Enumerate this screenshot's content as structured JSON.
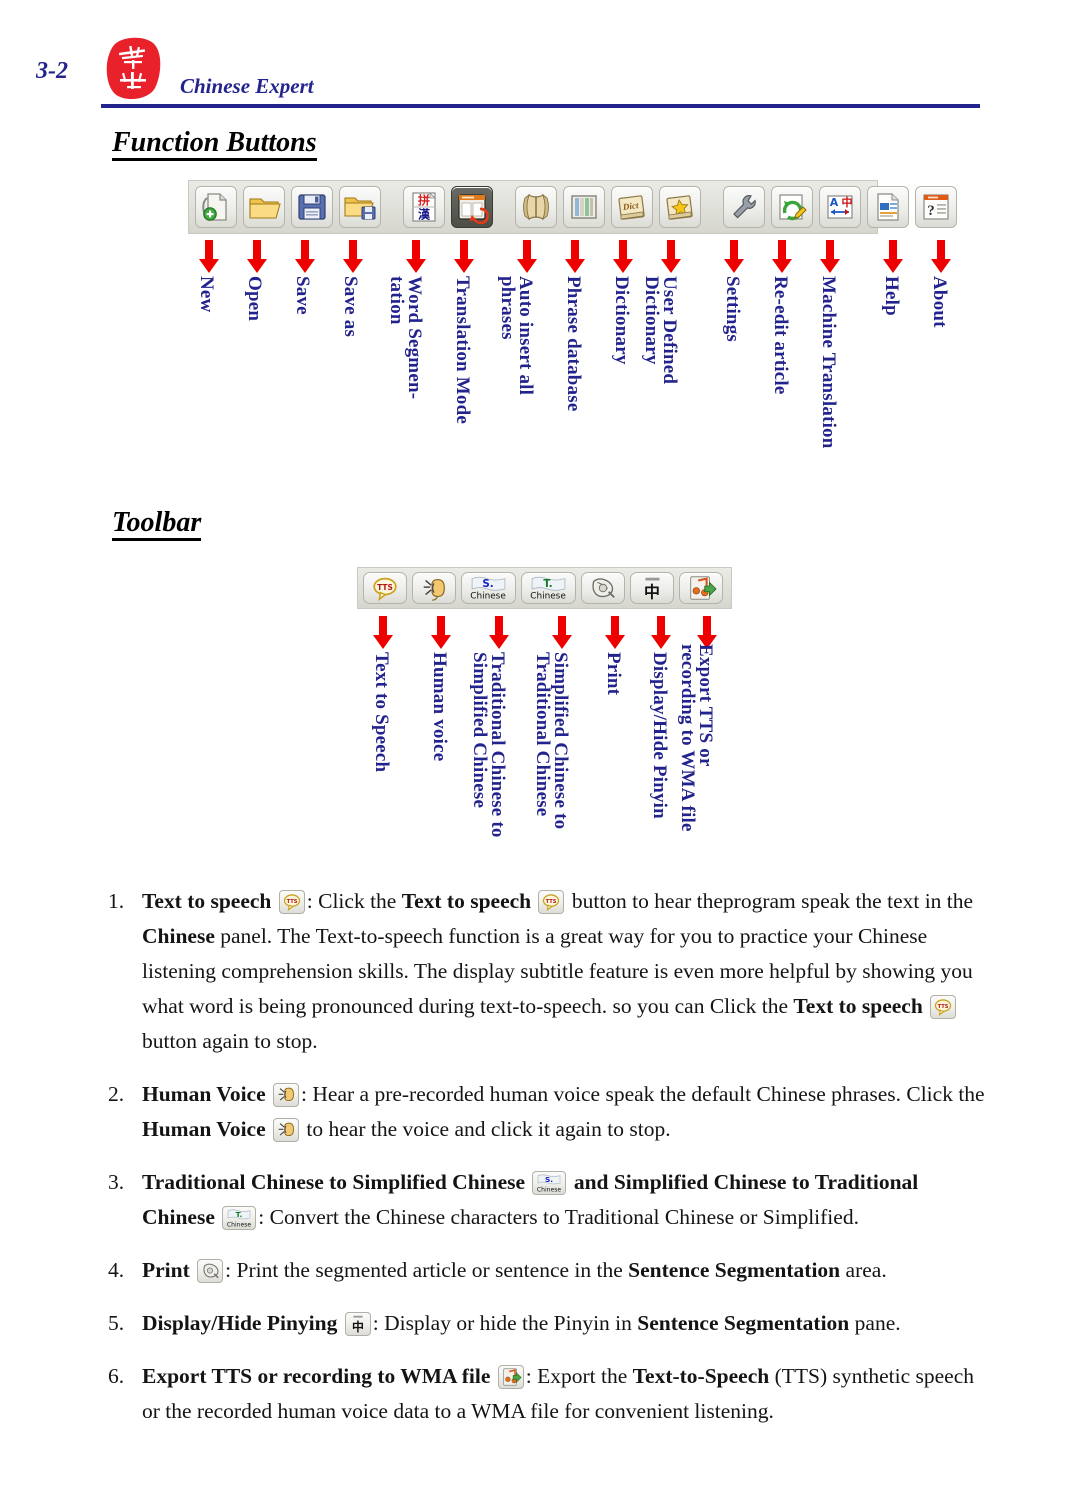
{
  "header": {
    "page_number": "3-2",
    "title": "Chinese Expert",
    "logo_name": "chinese-expert-seal-logo"
  },
  "sections": {
    "function_buttons": {
      "heading": "Function Buttons",
      "buttons": [
        {
          "icon": "new-document-icon",
          "label": "New"
        },
        {
          "icon": "open-folder-icon",
          "label": "Open"
        },
        {
          "icon": "save-floppy-icon",
          "label": "Save"
        },
        {
          "icon": "save-as-folder-icon",
          "label": "Save as"
        },
        {
          "icon": "word-segmentation-icon",
          "label": "Word Segmen-tation",
          "label_line1": "Word Segmen-",
          "label_line2": "tation"
        },
        {
          "icon": "translation-mode-icon",
          "label": "Translation Mode"
        },
        {
          "icon": "auto-insert-phrases-icon",
          "label": "Auto insert all phrases",
          "label_line1": "Auto insert all",
          "label_line2": "phrases"
        },
        {
          "icon": "phrase-database-icon",
          "label": "Phrase database"
        },
        {
          "icon": "dictionary-icon",
          "label": "Dictionary"
        },
        {
          "icon": "user-defined-dictionary-icon",
          "label": "User Defined Dictionary",
          "label_line1": "User Defined",
          "label_line2": "Dictionary"
        },
        {
          "icon": "settings-wrench-icon",
          "label": "Settings"
        },
        {
          "icon": "re-edit-article-icon",
          "label": "Re-edit article"
        },
        {
          "icon": "machine-translation-icon",
          "label": "Machine Translation"
        },
        {
          "icon": "help-icon",
          "label": "Help"
        },
        {
          "icon": "about-icon",
          "label": "About"
        }
      ]
    },
    "toolbar": {
      "heading": "Toolbar",
      "buttons": [
        {
          "icon": "tts-icon",
          "label": "Text to Speech"
        },
        {
          "icon": "human-voice-icon",
          "label": "Human voice"
        },
        {
          "icon": "simplified-chinese-icon",
          "label": "Traditional Chinese to Simplified Chinese",
          "label_line1": "Traditional Chinese to",
          "label_line2": "Simplified Chinese"
        },
        {
          "icon": "traditional-chinese-icon",
          "label": "Simplified Chinese to Traditional Chinese",
          "label_line1": "Simplified Chinese to",
          "label_line2": "Traditional Chinese"
        },
        {
          "icon": "print-icon",
          "label": "Print"
        },
        {
          "icon": "display-hide-pinyin-icon",
          "label": "Display/Hide Pinyin"
        },
        {
          "icon": "export-wma-icon",
          "label": "Export TTS or recording to WMA file",
          "label_line1": "Export TTS or",
          "label_line2": "recording to WMA file"
        }
      ]
    }
  },
  "list_items": [
    {
      "number": "1.",
      "segments": [
        {
          "t": "b",
          "v": "Text to speech "
        },
        {
          "t": "icon",
          "v": "tts-icon"
        },
        {
          "t": "n",
          "v": ": Click the "
        },
        {
          "t": "b",
          "v": "Text to speech "
        },
        {
          "t": "icon",
          "v": "tts-icon"
        },
        {
          "t": "n",
          "v": " button to hear theprogram speak the text in the "
        },
        {
          "t": "b",
          "v": "Chinese"
        },
        {
          "t": "n",
          "v": " panel. The Text-to-speech function is a great way for you to practice your Chinese listening comprehension skills. The display subtitle feature is even more helpful by showing you what word is being pronounced during text-to-speech. so you can Click the "
        },
        {
          "t": "b",
          "v": "Text to speech "
        },
        {
          "t": "icon",
          "v": "tts-icon"
        },
        {
          "t": "n",
          "v": " button again to stop."
        }
      ]
    },
    {
      "number": "2.",
      "segments": [
        {
          "t": "b",
          "v": "Human Voice "
        },
        {
          "t": "icon",
          "v": "human-voice-icon"
        },
        {
          "t": "n",
          "v": ": Hear a pre-recorded human voice speak the default Chinese phrases. Click the "
        },
        {
          "t": "b",
          "v": "Human Voice "
        },
        {
          "t": "icon",
          "v": "human-voice-icon"
        },
        {
          "t": "n",
          "v": " to hear the voice and click it again to stop."
        }
      ]
    },
    {
      "number": "3.",
      "segments": [
        {
          "t": "b",
          "v": "Traditional Chinese to Simplified Chinese "
        },
        {
          "t": "icon",
          "v": "simplified-chinese-icon"
        },
        {
          "t": "b",
          "v": " and Simplified Chinese to Traditional Chinese "
        },
        {
          "t": "icon",
          "v": "traditional-chinese-icon"
        },
        {
          "t": "n",
          "v": ": Convert the Chinese characters to Traditional Chinese or Simplified."
        }
      ]
    },
    {
      "number": "4.",
      "segments": [
        {
          "t": "b",
          "v": "Print "
        },
        {
          "t": "icon",
          "v": "print-icon"
        },
        {
          "t": "n",
          "v": ": Print the segmented article or sentence in the "
        },
        {
          "t": "b",
          "v": "Sentence Segmentation"
        },
        {
          "t": "n",
          "v": " area."
        }
      ]
    },
    {
      "number": "5.",
      "segments": [
        {
          "t": "b",
          "v": "Display/Hide Pinying "
        },
        {
          "t": "icon",
          "v": "display-hide-pinyin-icon"
        },
        {
          "t": "n",
          "v": ": Display or hide the Pinyin in "
        },
        {
          "t": "b",
          "v": "Sentence Segmentation"
        },
        {
          "t": "n",
          "v": " pane."
        }
      ]
    },
    {
      "number": "6.",
      "segments": [
        {
          "t": "b",
          "v": "Export TTS or recording to WMA file "
        },
        {
          "t": "icon",
          "v": "export-wma-icon"
        },
        {
          "t": "n",
          "v": ": Export the "
        },
        {
          "t": "b",
          "v": "Text-to-Speech"
        },
        {
          "t": "n",
          "v": " (TTS) synthetic speech or the recorded human voice data to a WMA file for convenient listening."
        }
      ]
    }
  ],
  "colors": {
    "heading_navy": "#23238e",
    "arrow_red": "#ee0000",
    "seal_red": "#e8212a",
    "text_black": "#141414",
    "toolbar_bg": "#e2e2dc"
  }
}
